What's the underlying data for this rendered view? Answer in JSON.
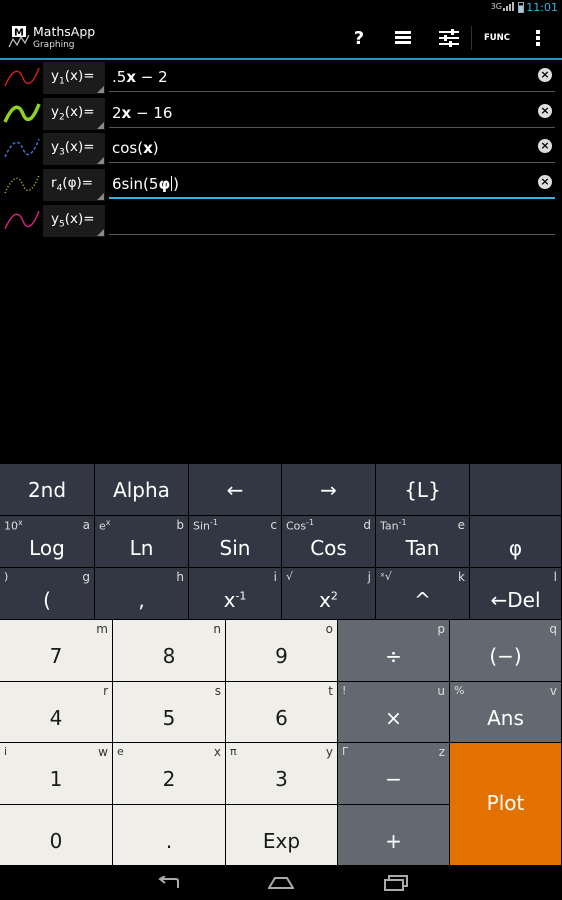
{
  "status": {
    "network": "3G",
    "time": "11:01"
  },
  "header": {
    "app_name": "MathsApp",
    "subtitle": "Graphing",
    "func_label": "FUNC",
    "help_label": "?"
  },
  "functions": [
    {
      "name": "y",
      "sub": "1",
      "var": "x",
      "expr_pre": ".5",
      "expr_bold": "x",
      "expr_post": " − 2",
      "color": "#cc1f1f",
      "style": "solid-thin"
    },
    {
      "name": "y",
      "sub": "2",
      "var": "x",
      "expr_pre": "2",
      "expr_bold": "x",
      "expr_post": " − 16",
      "color": "#8fd321",
      "style": "solid-thick"
    },
    {
      "name": "y",
      "sub": "3",
      "var": "x",
      "expr_pre": "cos(",
      "expr_bold": "x",
      "expr_post": ")",
      "color": "#3f6fd8",
      "style": "dashed"
    },
    {
      "name": "r",
      "sub": "4",
      "var": "φ",
      "expr_pre": "6sin(5",
      "expr_bold": "φ",
      "expr_post": ")",
      "color": "#b9a52a",
      "style": "dotted"
    },
    {
      "name": "y",
      "sub": "5",
      "var": "x",
      "expr_pre": "",
      "expr_bold": "",
      "expr_post": "",
      "color": "#d1247d",
      "style": "solid-thin"
    }
  ],
  "keys": {
    "row1": [
      "2nd",
      "Alpha",
      "←",
      "→",
      "{L}"
    ],
    "row2": [
      {
        "label": "Log",
        "sup": "10",
        "supx": "x",
        "alt": "a"
      },
      {
        "label": "Ln",
        "sup": "e",
        "supx": "x",
        "alt": "b"
      },
      {
        "label": "Sin",
        "sup": "Sin",
        "supx": "-1",
        "alt": "c"
      },
      {
        "label": "Cos",
        "sup": "Cos",
        "supx": "-1",
        "alt": "d"
      },
      {
        "label": "Tan",
        "sup": "Tan",
        "supx": "-1",
        "alt": "e"
      },
      {
        "label": "φ",
        "sup": "",
        "supx": "",
        "alt": ""
      }
    ],
    "row3": [
      {
        "label": "(",
        "sup": ")",
        "alt": "g"
      },
      {
        "label": ",",
        "sup": "",
        "alt": "h"
      },
      {
        "label": "x",
        "labelsup": "-1",
        "sup": "",
        "alt": "i"
      },
      {
        "label": "x",
        "labelsup": "2",
        "sup": "√",
        "alt": "j"
      },
      {
        "label": "^",
        "sup": "ˣ√",
        "alt": "k"
      },
      {
        "label": "←Del",
        "sup": "",
        "alt": "l"
      }
    ],
    "digits": [
      [
        {
          "label": "7",
          "sup": "",
          "alt": "m"
        },
        {
          "label": "8",
          "sup": "",
          "alt": "n"
        },
        {
          "label": "9",
          "sup": "",
          "alt": "o"
        },
        {
          "label": "÷",
          "sup": "",
          "alt": "p"
        },
        {
          "label": "(−)",
          "sup": "",
          "alt": "q"
        }
      ],
      [
        {
          "label": "4",
          "sup": "",
          "alt": "r"
        },
        {
          "label": "5",
          "sup": "",
          "alt": "s"
        },
        {
          "label": "6",
          "sup": "",
          "alt": "t"
        },
        {
          "label": "×",
          "sup": "!",
          "alt": "u"
        },
        {
          "label": "Ans",
          "sup": "%",
          "alt": "v"
        }
      ],
      [
        {
          "label": "1",
          "sup": "i",
          "alt": "w"
        },
        {
          "label": "2",
          "sup": "e",
          "alt": "x"
        },
        {
          "label": "3",
          "sup": "π",
          "alt": "y"
        },
        {
          "label": "−",
          "sup": "Γ",
          "alt": "z"
        }
      ],
      [
        {
          "label": "0",
          "sup": "",
          "alt": ""
        },
        {
          "label": ".",
          "sup": "",
          "alt": ""
        },
        {
          "label": "Exp",
          "sup": "",
          "alt": ""
        },
        {
          "label": "+",
          "sup": "",
          "alt": ""
        }
      ]
    ],
    "plot": "Plot"
  },
  "colors": {
    "accent": "#33b5e5",
    "plot": "#e37100",
    "dark_key": "#313843",
    "light_key": "#efeee8",
    "op_key": "#636970"
  }
}
